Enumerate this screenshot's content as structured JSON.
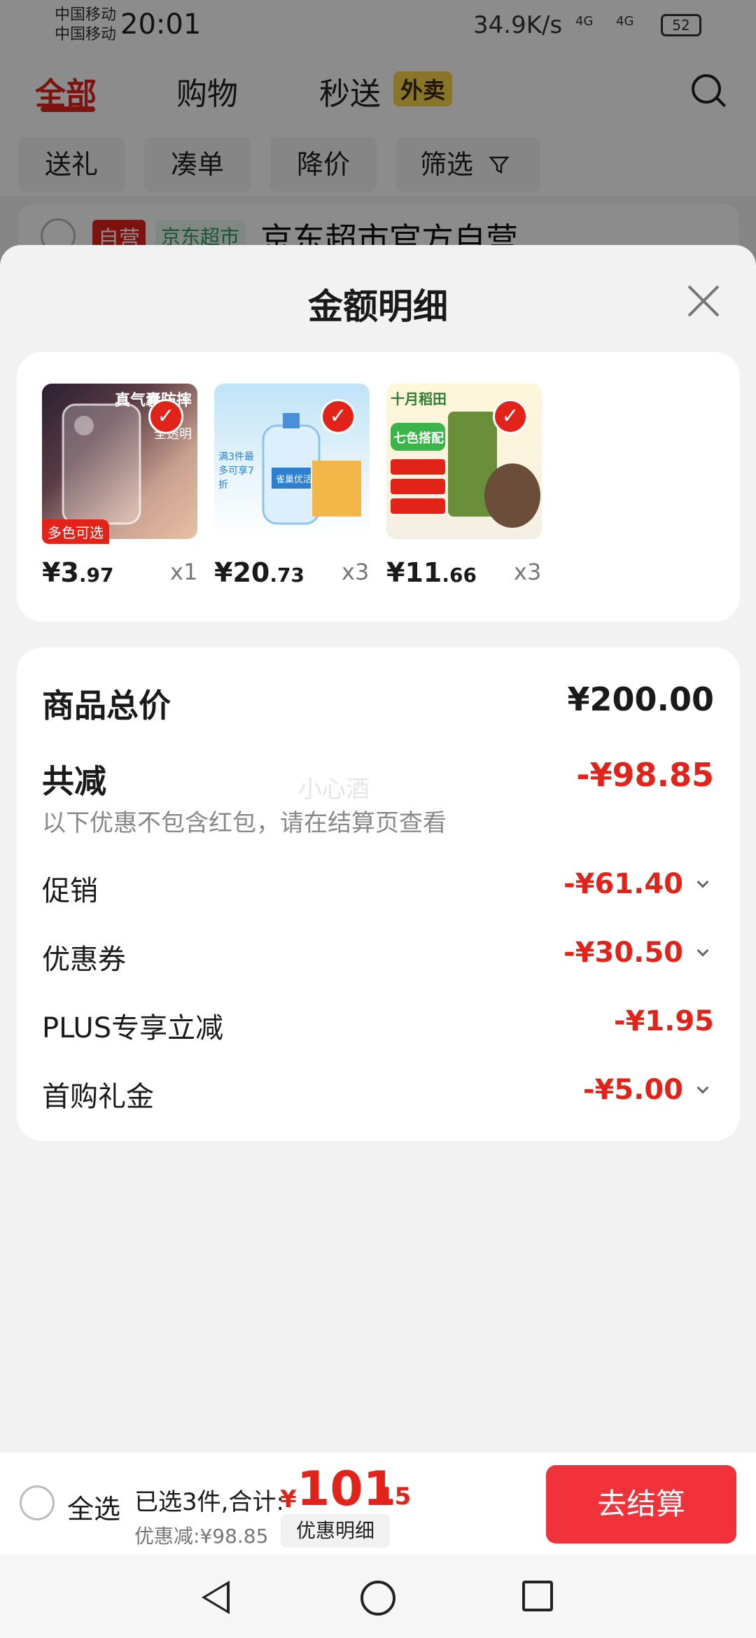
{
  "status_bar": {
    "carrier1": "中国移动",
    "carrier2": "中国移动",
    "time": "20:01",
    "net_speed": "34.9K/s",
    "signal1": "4G",
    "signal2": "4G",
    "battery": "52"
  },
  "tabs": [
    {
      "label": "全部"
    },
    {
      "label": "购物"
    },
    {
      "label": "秒送"
    }
  ],
  "tab_badge": "外卖",
  "filters": [
    "送礼",
    "凑单",
    "降价",
    "筛选"
  ],
  "store": {
    "badge_self": "自营",
    "badge_mart": "京东超市",
    "name": "京东超市官方自营"
  },
  "sheet": {
    "title": "金额明细",
    "products": [
      {
        "img_text_1": "真气囊防摔",
        "img_text_2": "全透明",
        "tag": "多色可选",
        "price_yen": "¥3",
        "price_cents": ".97",
        "qty": "x1"
      },
      {
        "img_text_1": "雀巢优活",
        "img_text_2": "满3件最多可享7折",
        "price_yen": "¥20",
        "price_cents": ".73",
        "qty": "x3"
      },
      {
        "img_text_1": "十月稻田",
        "img_text_2": "七色搭配",
        "price_yen": "¥11",
        "price_cents": ".66",
        "qty": "x3"
      }
    ],
    "summary": {
      "total_label": "商品总价",
      "total_value": "¥200.00",
      "reduce_label": "共减",
      "reduce_value": "-¥98.85",
      "note": "以下优惠不包含红包，请在结算页查看",
      "watermark": "小心酒",
      "items": [
        {
          "label": "促销",
          "value": "-¥61.40"
        },
        {
          "label": "优惠券",
          "value": "-¥30.50"
        },
        {
          "label": "PLUS专享立减",
          "value": "-¥1.95"
        },
        {
          "label": "首购礼金",
          "value": "-¥5.00"
        }
      ]
    }
  },
  "bottom": {
    "select_all": "全选",
    "selected": "已选3件,合计:",
    "yen": "¥",
    "total_int": "101",
    "total_cents": ".15",
    "discount": "优惠减:¥98.85",
    "detail_button": "优惠明细",
    "checkout_button": "去结算"
  },
  "colors": {
    "accent": "#e2231a",
    "checkout": "#f1323a"
  }
}
